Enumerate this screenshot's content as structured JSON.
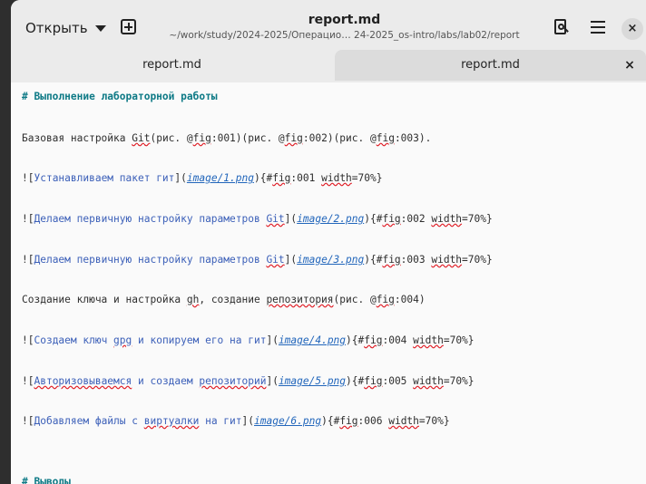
{
  "header": {
    "open_label": "Открыть",
    "title": "report.md",
    "path": "~/work/study/2024-2025/Операцио… 24-2025_os-intro/labs/lab02/report",
    "close_glyph": "×"
  },
  "tabs": [
    {
      "label": "report.md"
    },
    {
      "label": "report.md",
      "close_glyph": "×"
    }
  ],
  "editor": {
    "l1": "# Выполнение лабораторной работы",
    "l2": {
      "a": "Базовая настройка ",
      "b": "Git",
      "c": "(рис. @",
      "d": "fig",
      "e": ":001)(рис. @",
      "f": "fig",
      "g": ":002)(рис. @",
      "h": "fig",
      "i": ":003)."
    },
    "l3": {
      "a": "![",
      "b": "Устанавливаем пакет гит",
      "c": "](",
      "d": "image/1.png",
      "e": "){#",
      "f": "fig",
      "g": ":001 ",
      "h": "width",
      "i": "=70%}"
    },
    "l4": {
      "a": "![",
      "b": "Делаем первичную настройку параметров ",
      "b2": "Git",
      "c": "](",
      "d": "image/2.png",
      "e": "){#",
      "f": "fig",
      "g": ":002 ",
      "h": "width",
      "i": "=70%}"
    },
    "l5": {
      "a": "![",
      "b": "Делаем первичную настройку параметров ",
      "b2": "Git",
      "c": "](",
      "d": "image/3.png",
      "e": "){#",
      "f": "fig",
      "g": ":003 ",
      "h": "width",
      "i": "=70%}"
    },
    "l6": {
      "a": "Создание ключа и настройка ",
      "b": "gh",
      "c": ", создание ",
      "d": "репозитория",
      "e": "(рис. @",
      "f": "fig",
      "g": ":004)"
    },
    "l7": {
      "a": "![",
      "b": "Создаем ключ ",
      "b2": "gpg",
      "b3": " и копируем его на гит",
      "c": "](",
      "d": "image/4.png",
      "e": "){#",
      "f": "fig",
      "g": ":004 ",
      "h": "width",
      "i": "=70%}"
    },
    "l8": {
      "a": "![",
      "b": "Авторизовываемся",
      "b2": " и создаем ",
      "b3": "репозиторий",
      "c": "](",
      "d": "image/5.png",
      "e": "){#",
      "f": "fig",
      "g": ":005 ",
      "h": "width",
      "i": "=70%}"
    },
    "l9": {
      "a": "![",
      "b": "Добавляем файлы с ",
      "b2": "виртуалки",
      "b3": " на гит",
      "c": "](",
      "d": "image/6.png",
      "e": "){#",
      "f": "fig",
      "g": ":006 ",
      "h": "width",
      "i": "=70%}"
    },
    "l10": "# Выводы"
  }
}
